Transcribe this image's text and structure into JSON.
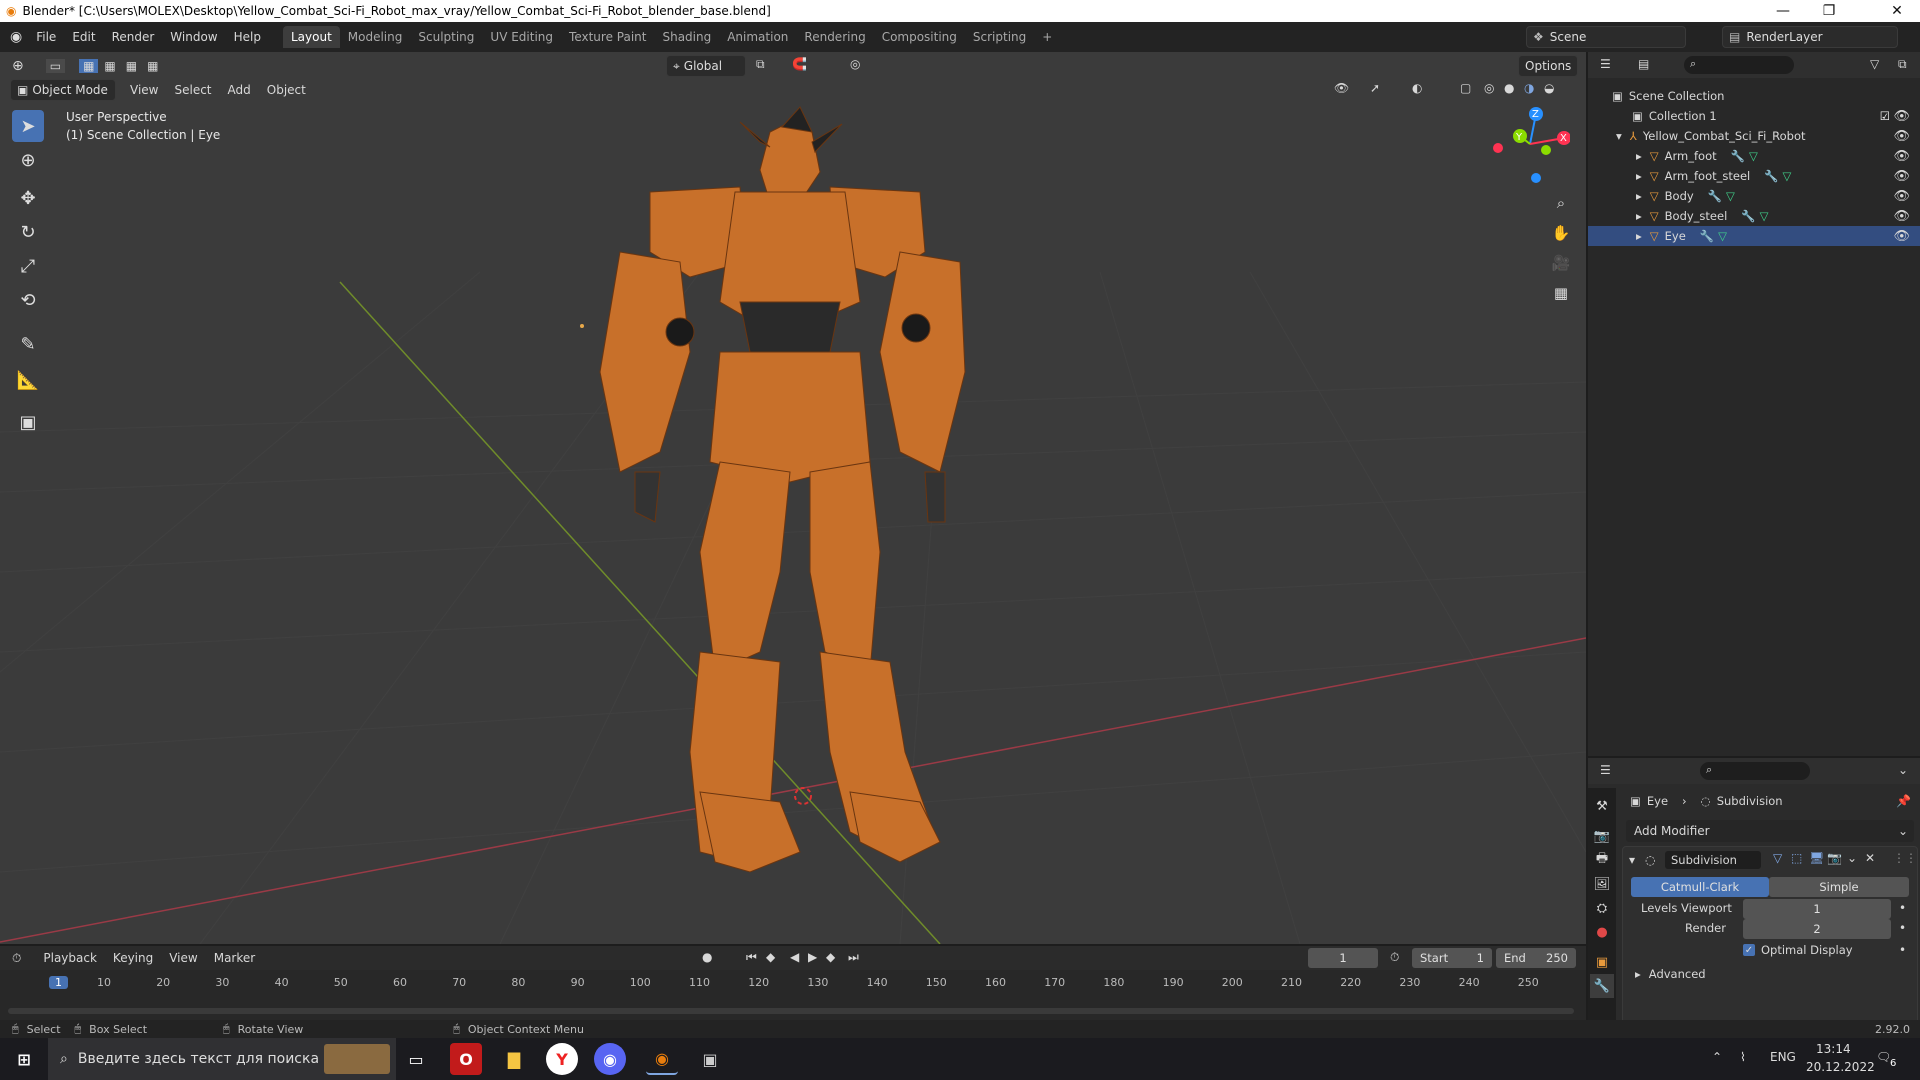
{
  "window": {
    "title": "Blender* [C:\\Users\\MOLEX\\Desktop\\Yellow_Combat_Sci-Fi_Robot_max_vray/Yellow_Combat_Sci-Fi_Robot_blender_base.blend]",
    "minimize": "—",
    "maximize": "❐",
    "close": "✕"
  },
  "menubar": {
    "items": [
      "File",
      "Edit",
      "Render",
      "Window",
      "Help"
    ],
    "workspaces": [
      "Layout",
      "Modeling",
      "Sculpting",
      "UV Editing",
      "Texture Paint",
      "Shading",
      "Animation",
      "Rendering",
      "Compositing",
      "Scripting"
    ],
    "active_workspace": "Layout",
    "add_workspace": "+",
    "scene": "Scene",
    "render_layer": "RenderLayer"
  },
  "viewport_header": {
    "transform_orientation": "Global",
    "options": "Options",
    "mode": "Object Mode",
    "menus": [
      "View",
      "Select",
      "Add",
      "Object"
    ]
  },
  "viewport": {
    "perspective": "User Perspective",
    "context": "(1) Scene Collection | Eye",
    "gizmo": {
      "z": "Z",
      "y": "Y",
      "x": "X"
    }
  },
  "outliner": {
    "root": "Scene Collection",
    "collection": "Collection 1",
    "object_parent": "Yellow_Combat_Sci_Fi_Robot",
    "children": [
      "Arm_foot",
      "Arm_foot_steel",
      "Body",
      "Body_steel",
      "Eye"
    ]
  },
  "properties": {
    "object": "Eye",
    "modifier_breadcrumb": "Subdivision",
    "add_modifier": "Add Modifier",
    "modifier_name": "Subdivision",
    "mode_options": [
      "Catmull-Clark",
      "Simple"
    ],
    "active_mode": "Catmull-Clark",
    "levels_viewport_label": "Levels Viewport",
    "levels_viewport": "1",
    "render_label": "Render",
    "render_levels": "2",
    "optimal_display": "Optimal Display",
    "advanced": "Advanced"
  },
  "timeline": {
    "menus": [
      "Playback",
      "Keying",
      "View",
      "Marker"
    ],
    "current_frame": "1",
    "start_label": "Start",
    "start": "1",
    "end_label": "End",
    "end": "250",
    "ruler": [
      "1",
      "10",
      "20",
      "30",
      "40",
      "50",
      "60",
      "70",
      "80",
      "90",
      "100",
      "110",
      "120",
      "130",
      "140",
      "150",
      "160",
      "170",
      "180",
      "190",
      "200",
      "210",
      "220",
      "230",
      "240",
      "250"
    ]
  },
  "statusbar": {
    "select": "Select",
    "box_select": "Box Select",
    "rotate_view": "Rotate View",
    "context_menu": "Object Context Menu",
    "version": "2.92.0"
  },
  "taskbar": {
    "search_placeholder": "Введите здесь текст для поиска",
    "lang": "ENG",
    "time": "13:14",
    "date": "20.12.2022",
    "notifications": "6"
  },
  "colors": {
    "accent": "#4772b3",
    "robot_orange": "#c8702a",
    "x_axis": "#ff3352",
    "y_axis": "#8bdc00",
    "z_axis": "#2890ff"
  }
}
